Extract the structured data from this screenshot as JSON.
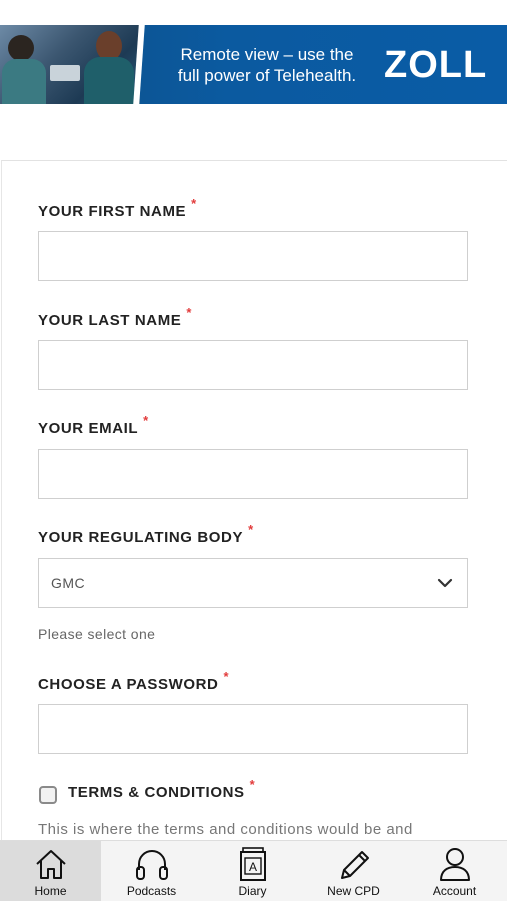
{
  "banner": {
    "text_line1": "Remote view – use the",
    "text_line2": "full power of Telehealth.",
    "logo": "ZOLL",
    "colors": {
      "background": "#0b5aa0",
      "text": "#ffffff"
    }
  },
  "form": {
    "first_name": {
      "label": "YOUR FIRST NAME",
      "required_mark": "*",
      "value": ""
    },
    "last_name": {
      "label": "YOUR LAST NAME",
      "required_mark": "*",
      "value": ""
    },
    "email": {
      "label": "YOUR EMAIL",
      "required_mark": "*",
      "value": ""
    },
    "regulating_body": {
      "label": "YOUR REGULATING BODY",
      "required_mark": "*",
      "selected": "GMC",
      "help": "Please select one",
      "icon": "chevron-down-icon"
    },
    "password": {
      "label": "CHOOSE A PASSWORD",
      "required_mark": "*",
      "value": ""
    },
    "terms": {
      "label": "TERMS & CONDITIONS",
      "required_mark": "*",
      "checked": false,
      "text": "This is where the terms and conditions would be and"
    },
    "colors": {
      "required": "#e23b3b",
      "border": "#cfcfcf"
    }
  },
  "tabbar": {
    "items": [
      {
        "label": "Home",
        "icon": "home-icon",
        "active": true
      },
      {
        "label": "Podcasts",
        "icon": "headphones-icon",
        "active": false
      },
      {
        "label": "Diary",
        "icon": "diary-book-icon",
        "active": false
      },
      {
        "label": "New CPD",
        "icon": "pencil-icon",
        "active": false
      },
      {
        "label": "Account",
        "icon": "user-icon",
        "active": false
      }
    ],
    "colors": {
      "background": "#f4f4f4",
      "active_background": "#dcdcdc"
    }
  }
}
